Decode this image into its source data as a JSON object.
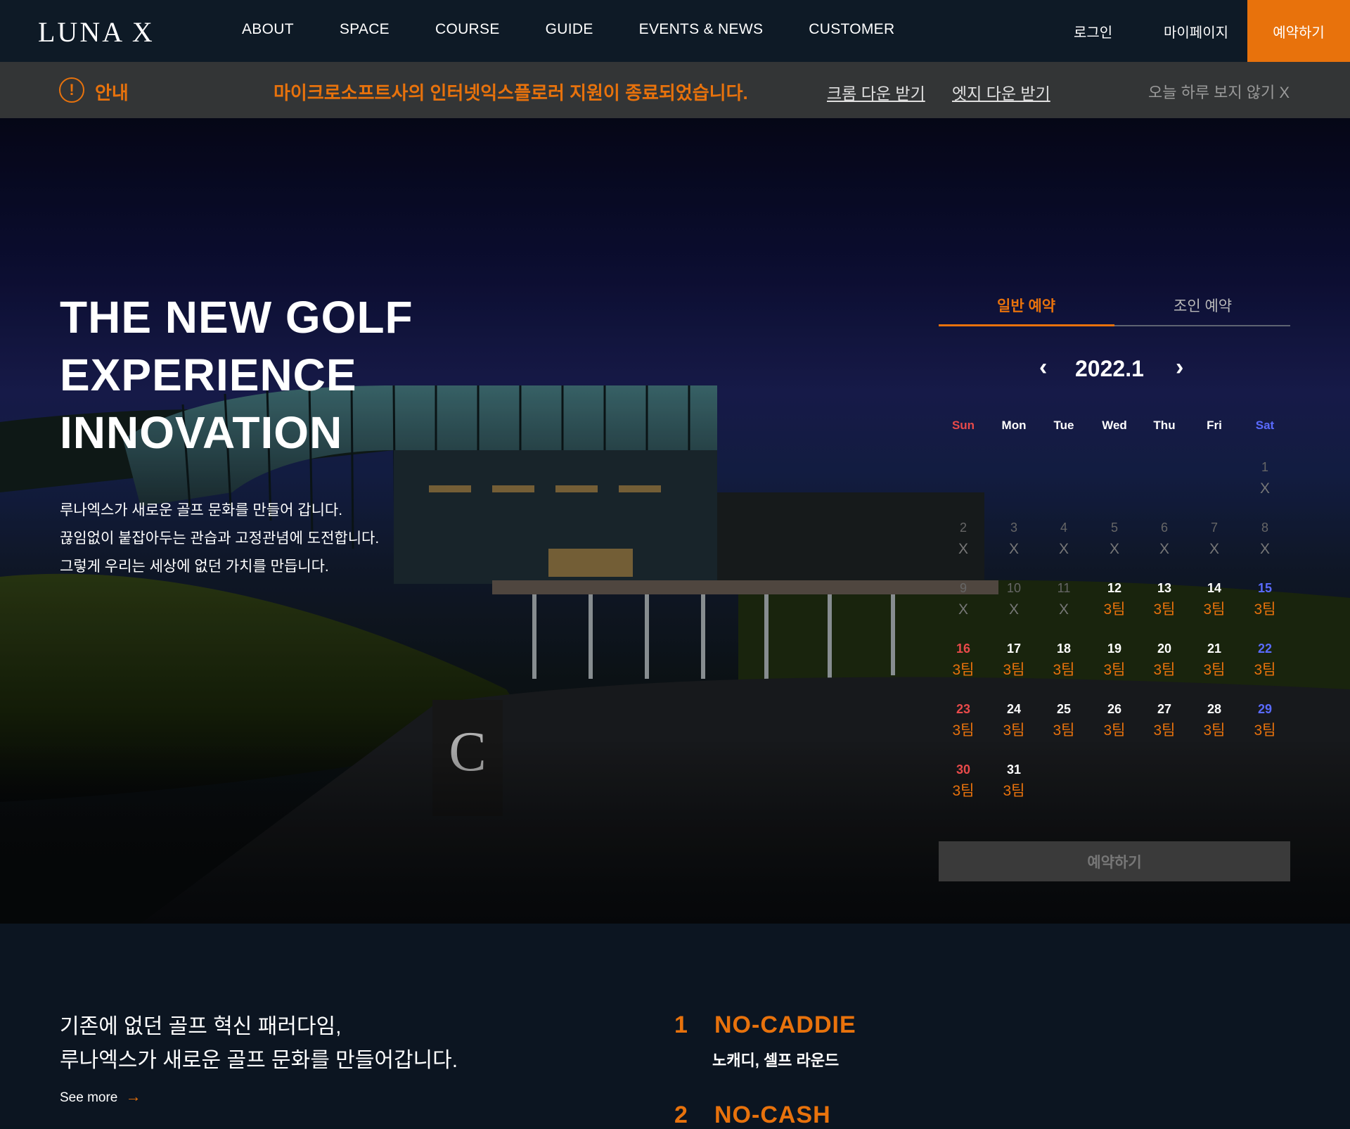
{
  "header": {
    "logo": "LUNA X",
    "nav": [
      "ABOUT",
      "SPACE",
      "COURSE",
      "GUIDE",
      "EVENTS & NEWS",
      "CUSTOMER"
    ],
    "login": "로그인",
    "mypage": "마이페이지",
    "reserve": "예약하기",
    "accent_color": "#e8720c"
  },
  "notice": {
    "icon": "alert-circle-icon",
    "label": "안내",
    "message": "마이크로소프트사의 인터넷익스플로러 지원이 종료되었습니다.",
    "chrome_link": "크롬 다운 받기",
    "edge_link": "엣지 다운 받기",
    "close": "오늘 하루 보지 않기 X"
  },
  "hero": {
    "title": [
      "THE NEW GOLF",
      "EXPERIENCE",
      "INNOVATION"
    ],
    "desc": [
      "루나엑스가 새로운 골프 문화를 만들어 갑니다.",
      "끊임없이 붙잡아두는 관습과 고정관념에 도전합니다.",
      "그렇게 우리는 세상에 없던 가치를 만듭니다."
    ]
  },
  "reservation": {
    "tabs": [
      "일반 예약",
      "조인 예약"
    ],
    "active_tab": 0,
    "month": "2022.1",
    "weekdays": [
      "Sun",
      "Mon",
      "Tue",
      "Wed",
      "Thu",
      "Fri",
      "Sat"
    ],
    "days": [
      {
        "day": "1",
        "status": "X",
        "available": false
      },
      {
        "day": "2",
        "status": "X",
        "available": false
      },
      {
        "day": "3",
        "status": "X",
        "available": false
      },
      {
        "day": "4",
        "status": "X",
        "available": false
      },
      {
        "day": "5",
        "status": "X",
        "available": false
      },
      {
        "day": "6",
        "status": "X",
        "available": false
      },
      {
        "day": "7",
        "status": "X",
        "available": false
      },
      {
        "day": "8",
        "status": "X",
        "available": false
      },
      {
        "day": "9",
        "status": "X",
        "available": false
      },
      {
        "day": "10",
        "status": "X",
        "available": false
      },
      {
        "day": "11",
        "status": "X",
        "available": false
      },
      {
        "day": "12",
        "status": "3팀",
        "available": true
      },
      {
        "day": "13",
        "status": "3팀",
        "available": true
      },
      {
        "day": "14",
        "status": "3팀",
        "available": true
      },
      {
        "day": "15",
        "status": "3팀",
        "available": true
      },
      {
        "day": "16",
        "status": "3팀",
        "available": true
      },
      {
        "day": "17",
        "status": "3팀",
        "available": true
      },
      {
        "day": "18",
        "status": "3팀",
        "available": true
      },
      {
        "day": "19",
        "status": "3팀",
        "available": true
      },
      {
        "day": "20",
        "status": "3팀",
        "available": true
      },
      {
        "day": "21",
        "status": "3팀",
        "available": true
      },
      {
        "day": "22",
        "status": "3팀",
        "available": true
      },
      {
        "day": "23",
        "status": "3팀",
        "available": true
      },
      {
        "day": "24",
        "status": "3팀",
        "available": true
      },
      {
        "day": "25",
        "status": "3팀",
        "available": true
      },
      {
        "day": "26",
        "status": "3팀",
        "available": true
      },
      {
        "day": "27",
        "status": "3팀",
        "available": true
      },
      {
        "day": "28",
        "status": "3팀",
        "available": true
      },
      {
        "day": "29",
        "status": "3팀",
        "available": true
      },
      {
        "day": "30",
        "status": "3팀",
        "available": true
      },
      {
        "day": "31",
        "status": "3팀",
        "available": true
      }
    ],
    "first_weekday": 6,
    "button": "예약하기"
  },
  "intro": {
    "lines": [
      "기존에 없던 골프 혁신 패러다임,",
      "루나엑스가 새로운 골프 문화를 만들어갑니다."
    ],
    "see_more": "See more",
    "features": [
      {
        "num": "1",
        "title": "NO-CADDIE",
        "sub": "노캐디, 셀프 라운드"
      },
      {
        "num": "2",
        "title": "NO-CASH",
        "sub": ""
      }
    ]
  }
}
